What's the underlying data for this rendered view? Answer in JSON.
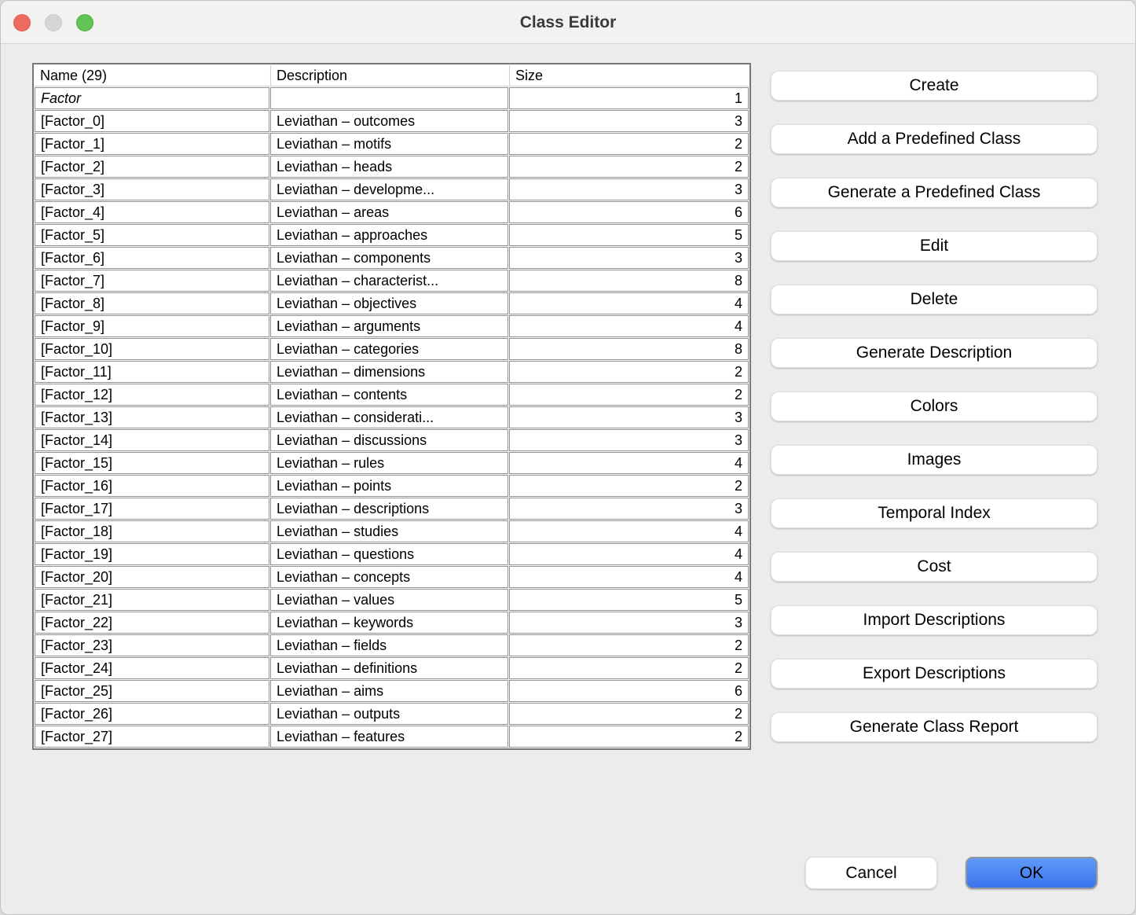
{
  "window": {
    "title": "Class Editor"
  },
  "titlebar": {
    "close_icon": "red-circle",
    "minimize_icon": "gray-circle",
    "zoom_icon": "green-circle"
  },
  "table": {
    "columns": [
      "Name (29)",
      "Description",
      "Size"
    ],
    "rows": [
      {
        "name": "Factor",
        "description": "",
        "size": 1,
        "italic": true
      },
      {
        "name": "[Factor_0]",
        "description": "Leviathan – outcomes",
        "size": 3
      },
      {
        "name": "[Factor_1]",
        "description": "Leviathan – motifs",
        "size": 2
      },
      {
        "name": "[Factor_2]",
        "description": "Leviathan – heads",
        "size": 2
      },
      {
        "name": "[Factor_3]",
        "description": "Leviathan – developme...",
        "size": 3
      },
      {
        "name": "[Factor_4]",
        "description": "Leviathan – areas",
        "size": 6
      },
      {
        "name": "[Factor_5]",
        "description": "Leviathan – approaches",
        "size": 5
      },
      {
        "name": "[Factor_6]",
        "description": "Leviathan – components",
        "size": 3
      },
      {
        "name": "[Factor_7]",
        "description": "Leviathan – characterist...",
        "size": 8
      },
      {
        "name": "[Factor_8]",
        "description": "Leviathan – objectives",
        "size": 4
      },
      {
        "name": "[Factor_9]",
        "description": "Leviathan – arguments",
        "size": 4
      },
      {
        "name": "[Factor_10]",
        "description": "Leviathan – categories",
        "size": 8
      },
      {
        "name": "[Factor_11]",
        "description": "Leviathan – dimensions",
        "size": 2
      },
      {
        "name": "[Factor_12]",
        "description": "Leviathan – contents",
        "size": 2
      },
      {
        "name": "[Factor_13]",
        "description": "Leviathan – considerati...",
        "size": 3
      },
      {
        "name": "[Factor_14]",
        "description": "Leviathan – discussions",
        "size": 3
      },
      {
        "name": "[Factor_15]",
        "description": "Leviathan – rules",
        "size": 4
      },
      {
        "name": "[Factor_16]",
        "description": "Leviathan – points",
        "size": 2
      },
      {
        "name": "[Factor_17]",
        "description": "Leviathan – descriptions",
        "size": 3
      },
      {
        "name": "[Factor_18]",
        "description": "Leviathan – studies",
        "size": 4
      },
      {
        "name": "[Factor_19]",
        "description": "Leviathan – questions",
        "size": 4
      },
      {
        "name": "[Factor_20]",
        "description": "Leviathan – concepts",
        "size": 4
      },
      {
        "name": "[Factor_21]",
        "description": "Leviathan – values",
        "size": 5
      },
      {
        "name": "[Factor_22]",
        "description": "Leviathan – keywords",
        "size": 3
      },
      {
        "name": "[Factor_23]",
        "description": "Leviathan – fields",
        "size": 2
      },
      {
        "name": "[Factor_24]",
        "description": "Leviathan – definitions",
        "size": 2
      },
      {
        "name": "[Factor_25]",
        "description": "Leviathan – aims",
        "size": 6
      },
      {
        "name": "[Factor_26]",
        "description": "Leviathan – outputs",
        "size": 2
      },
      {
        "name": "[Factor_27]",
        "description": "Leviathan – features",
        "size": 2
      }
    ]
  },
  "action_buttons": [
    "Create",
    "Add a Predefined Class",
    "Generate a Predefined Class",
    "Edit",
    "Delete",
    "Generate Description",
    "Colors",
    "Images",
    "Temporal Index",
    "Cost",
    "Import Descriptions",
    "Export Descriptions",
    "Generate Class Report"
  ],
  "footer": {
    "cancel_label": "Cancel",
    "ok_label": "OK"
  },
  "colors": {
    "ok_button_blue": "#3a74ee",
    "traffic_close_red": "#ec6a5e",
    "traffic_minimize_gray": "#d8d6d5",
    "traffic_zoom_green": "#61c454",
    "window_background": "#ececec",
    "table_grid_gray": "#929292"
  }
}
